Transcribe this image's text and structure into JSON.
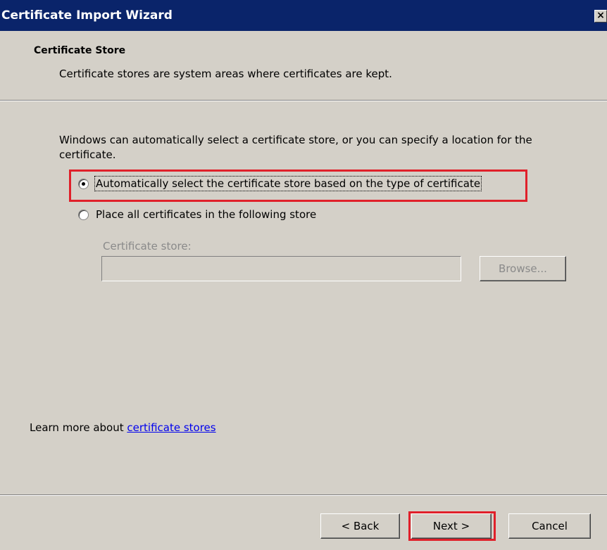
{
  "window": {
    "title": "Certificate Import Wizard",
    "close_label": "×"
  },
  "header": {
    "title": "Certificate Store",
    "description": "Certificate stores are system areas where certificates are kept."
  },
  "body": {
    "intro": "Windows can automatically select a certificate store, or you can specify a location for the certificate.",
    "options": [
      {
        "label": "Automatically select the certificate store based on the type of certificate",
        "checked": true
      },
      {
        "label": "Place all certificates in the following store",
        "checked": false
      }
    ],
    "store_label": "Certificate store:",
    "store_value": "",
    "browse_label": "Browse...",
    "learn_prefix": "Learn more about ",
    "learn_link": "certificate stores"
  },
  "footer": {
    "back_label": "< Back",
    "next_label": "Next >",
    "cancel_label": "Cancel"
  },
  "colors": {
    "title_bar": "#0a246a",
    "dialog_bg": "#d4d0c8",
    "highlight": "#e0202a",
    "link": "#0000ee"
  }
}
